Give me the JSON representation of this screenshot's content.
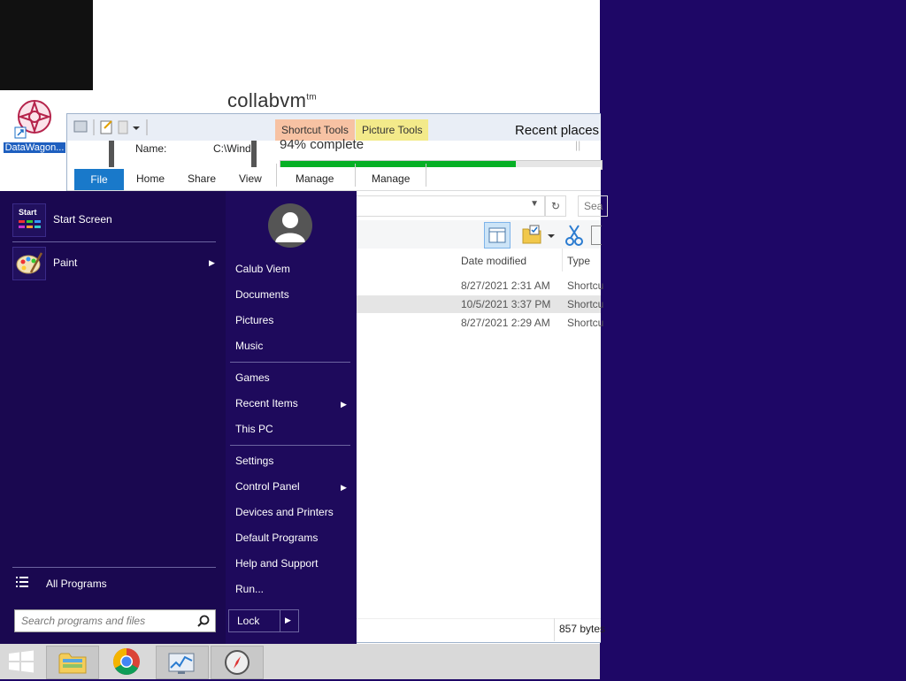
{
  "desktop": {
    "watermark": "collabvm",
    "watermark_sup": "tm",
    "icon_label": "DataWagon..."
  },
  "explorer": {
    "context_tabs": [
      "Shortcut Tools",
      "Picture Tools"
    ],
    "window_title": "Recent places",
    "name_label": "Name:",
    "name_value": "C:\\Wind",
    "progress_text": "94% complete",
    "progress": 0.94,
    "ribbon_tabs": [
      "File",
      "Home",
      "Share",
      "View",
      "Manage",
      "Manage"
    ],
    "search_placeholder": "Sea",
    "columns": [
      "Date modified",
      "Type"
    ],
    "rows": [
      {
        "date": "8/27/2021 2:31 AM",
        "type": "Shortcu"
      },
      {
        "date": "10/5/2021 3:37 PM",
        "type": "Shortcu"
      },
      {
        "date": "8/27/2021 2:29 AM",
        "type": "Shortcu"
      }
    ],
    "status": "857 bytes"
  },
  "startmenu": {
    "pinned": [
      {
        "label": "Start Screen",
        "tile_text": "Start"
      },
      {
        "label": "Paint"
      }
    ],
    "right": [
      "Calub Viem",
      "Documents",
      "Pictures",
      "Music",
      "Games",
      "Recent Items",
      "This PC",
      "Settings",
      "Control Panel",
      "Devices and Printers",
      "Default Programs",
      "Help and Support",
      "Run..."
    ],
    "all_programs": "All Programs",
    "search_placeholder": "Search programs and files",
    "lock": "Lock"
  },
  "colors": {
    "start_bg": "#1a0850",
    "desktop_bg": "#1e0766",
    "progress_fill": "#06b025",
    "file_tab": "#1979ca"
  },
  "taskbar": {
    "items": [
      "start-button",
      "file-explorer-icon",
      "chrome-icon",
      "resource-monitor-icon",
      "compass-app-icon"
    ]
  }
}
